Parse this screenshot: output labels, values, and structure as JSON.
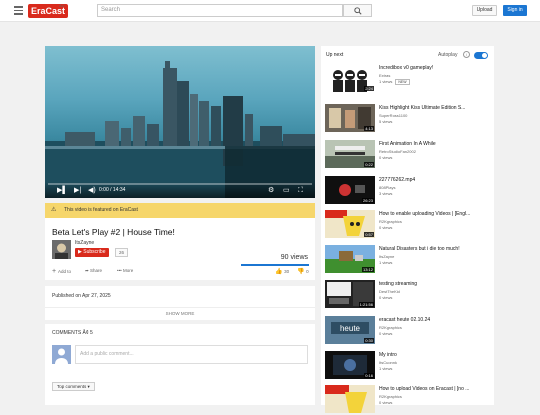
{
  "header": {
    "logo": "EraCast",
    "logo_sup": "AU",
    "search_placeholder": "Search",
    "upload_label": "Upload",
    "signin_label": "Sign in"
  },
  "player": {
    "time": "0:00 / 14:34",
    "featured": "This video is featured on EraCast",
    "progress_fraction": 0
  },
  "video": {
    "title": "Beta Let's Play #2 | House Time!",
    "channel": "ItsZayne",
    "subscribe_label": "Subscribe",
    "subscriber_count": "26",
    "views": "90 views",
    "add_to": "Add to",
    "share": "Share",
    "more": "More",
    "likes": "30",
    "dislikes": "0"
  },
  "description": {
    "published": "Published on Apr 27, 2025",
    "show_more": "SHOW MORE"
  },
  "comments": {
    "header": "COMMENTS Â¢ 5",
    "placeholder": "Add a public comment...",
    "sort_label": "Top comments"
  },
  "sidebar": {
    "up_next": "Up next",
    "autoplay": "Autoplay",
    "items": [
      {
        "title": "Incredibox v0 gameplay!",
        "channel": "Extras",
        "views": "1 views",
        "badge": "NEW",
        "duration": "2:24"
      },
      {
        "title": "Kiss Highlight Kiss Ultimate Edition S...",
        "channel": "SuperRoss1100",
        "views": "5 views",
        "badge": "",
        "duration": "4:13"
      },
      {
        "title": "First Animation In A While",
        "channel": "RetroStudioFan2002",
        "views": "0 views",
        "badge": "",
        "duration": "0:22"
      },
      {
        "title": "227776262.mp4",
        "channel": "808Plays",
        "views": "3 views",
        "badge": "",
        "duration": "26:23"
      },
      {
        "title": "How to enable uploading Videos | [Engl...",
        "channel": "R2Kgraphics",
        "views": "0 views",
        "badge": "",
        "duration": "0:57"
      },
      {
        "title": "Natural Disasters but i die too much!",
        "channel": "ItsZayne",
        "views": "1 views",
        "badge": "",
        "duration": "13:12"
      },
      {
        "title": "testing streaming",
        "channel": "DestTheKid",
        "views": "0 views",
        "badge": "",
        "duration": "1:21:56"
      },
      {
        "title": "eracast heute 02.10.24",
        "channel": "R2Kgraphics",
        "views": "0 views",
        "badge": "",
        "duration": "0:30"
      },
      {
        "title": "My intro",
        "channel": "ItsCuonnk",
        "views": "1 views",
        "badge": "",
        "duration": "0:16"
      },
      {
        "title": "How to upload Videos on Eracast | [no ...",
        "channel": "R2Kgraphics",
        "views": "0 views",
        "badge": "",
        "duration": ""
      }
    ]
  }
}
